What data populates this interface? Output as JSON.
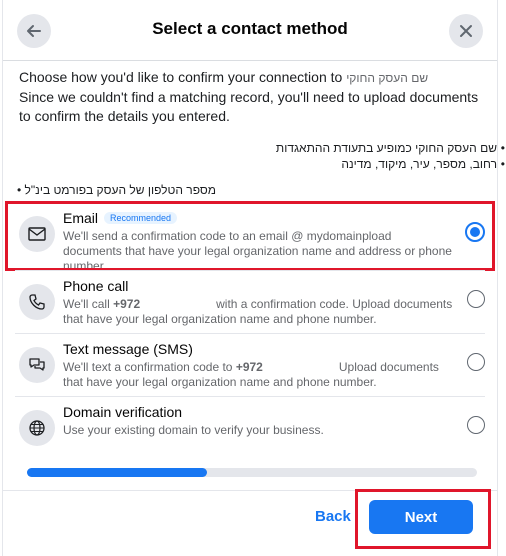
{
  "dialog": {
    "title": "Select a contact method",
    "back_icon": "arrow-left-icon",
    "close_icon": "close-icon"
  },
  "intro": {
    "line1": "Choose how you'd like to confirm your connection to",
    "business_name": "שם העסק החוקי",
    "line2": "Since we couldn't find a matching record, you'll need to upload documents to confirm the details you entered."
  },
  "requirements": {
    "rtl_items": [
      "שם העסק החוקי כמופיע בתעודת ההתאגדות",
      "רחוב, מספר, עיר, מיקוד, מדינה"
    ],
    "ltr_item": "מספר הטלפון של העסק בפורמט בינ\"ל"
  },
  "options": [
    {
      "title": "Email",
      "badge": "Recommended",
      "desc_a": "We'll send a confirmation code to an email @",
      "desc_domain": "mydomain",
      "desc_b": "pload documents that have your legal organization name and address or phone number.",
      "icon": "envelope-icon",
      "selected": true
    },
    {
      "title": "Phone call",
      "desc_a": "We'll call",
      "desc_num": "+972",
      "desc_b": "with a confirmation code. Upload documents that have your legal organization name and phone number.",
      "icon": "phone-icon",
      "selected": false
    },
    {
      "title": "Text message (SMS)",
      "desc_a": "We'll text a confirmation code to",
      "desc_num": "+972",
      "desc_b": "Upload documents that have your legal organization name and phone number.",
      "icon": "chat-bubbles-icon",
      "selected": false
    },
    {
      "title": "Domain verification",
      "desc_a": "Use your existing domain to verify your business.",
      "icon": "globe-icon",
      "selected": false
    }
  ],
  "progress": {
    "fraction": 0.4
  },
  "footer": {
    "back_label": "Back",
    "next_label": "Next"
  },
  "colors": {
    "accent": "#1877f2",
    "highlight": "#e0162b"
  }
}
